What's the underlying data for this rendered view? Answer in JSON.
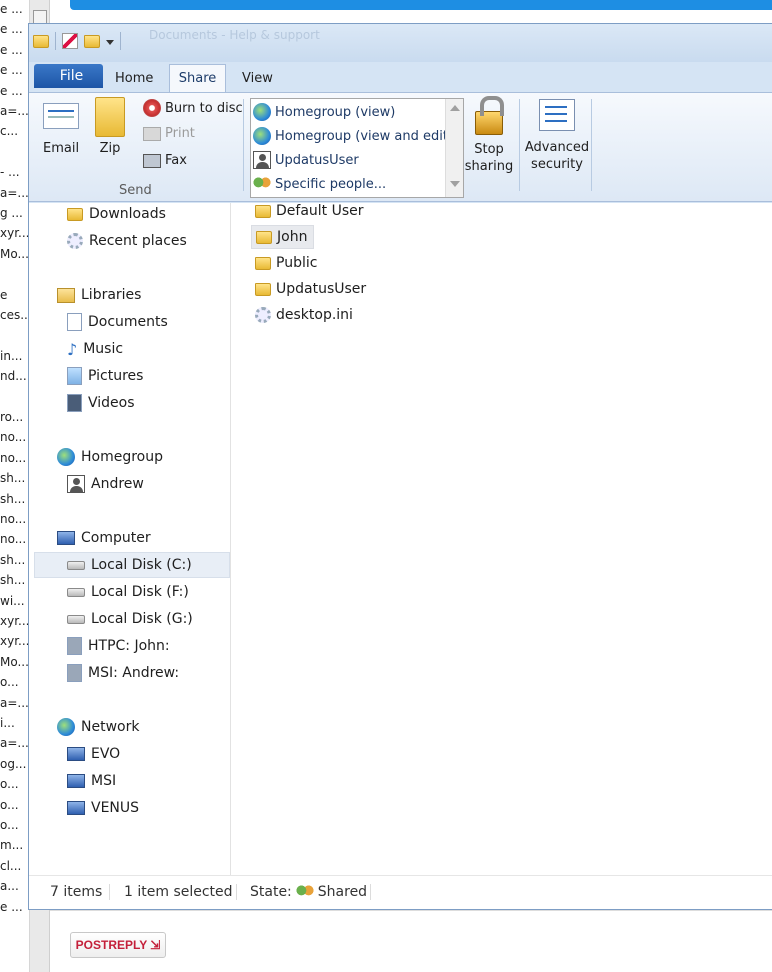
{
  "background": {
    "left_fragments": [
      "e ...",
      "e ...",
      "e ...",
      "e ...",
      "e ...",
      "a=...",
      "c...",
      "",
      "- ...",
      "a=...",
      "g ...",
      "xyr...",
      "Mo...",
      "",
      "e",
      "ces...",
      "",
      "in...",
      "nd...",
      "",
      "ro...",
      "no...",
      "no...",
      "sh...",
      "sh...",
      "no...",
      "no...",
      "sh...",
      "sh...",
      "wi...",
      "xyr...",
      "xyr...",
      "Mo...",
      "o...",
      "a=...",
      "i...",
      "a=...",
      "og...",
      "o...",
      "o...",
      "o...",
      "m...",
      "cl...",
      "a...",
      "e ..."
    ],
    "post_reply_label": "POSTREPLY",
    "post_reply_icon": "quote-arrow-icon"
  },
  "window": {
    "title": "Documents - Help & support",
    "quick_access": [
      "folder-icon",
      "properties-icon",
      "new-folder-icon",
      "customize-arrow-icon"
    ]
  },
  "ribbon": {
    "tabs": [
      {
        "label": "File"
      },
      {
        "label": "Home"
      },
      {
        "label": "Share",
        "active": true
      },
      {
        "label": "View"
      }
    ],
    "send": {
      "group_label": "Send",
      "email": "Email",
      "zip": "Zip",
      "burn": "Burn to disc",
      "print": "Print",
      "fax": "Fax"
    },
    "share_with": [
      {
        "label": "Homegroup (view)",
        "icon": "homegroup-icon"
      },
      {
        "label": "Homegroup (view and edit)",
        "icon": "homegroup-icon"
      },
      {
        "label": "UpdatusUser",
        "icon": "user-icon"
      },
      {
        "label": "Specific people...",
        "icon": "people-icon"
      }
    ],
    "stop_sharing": "Stop sharing",
    "advanced_security": "Advanced security"
  },
  "nav": {
    "favorites": [
      {
        "label": "Downloads",
        "icon": "downloads-icon"
      },
      {
        "label": "Recent places",
        "icon": "recent-places-icon"
      }
    ],
    "libraries": {
      "label": "Libraries",
      "items": [
        "Documents",
        "Music",
        "Pictures",
        "Videos"
      ]
    },
    "homegroup": {
      "label": "Homegroup",
      "items": [
        "Andrew"
      ]
    },
    "computer": {
      "label": "Computer",
      "items": [
        "Local Disk (C:)",
        "Local Disk (F:)",
        "Local Disk (G:)",
        "HTPC: John:",
        "MSI: Andrew:"
      ],
      "selected": "Local Disk (C:)"
    },
    "network": {
      "label": "Network",
      "items": [
        "EVO",
        "MSI",
        "VENUS"
      ]
    }
  },
  "files": [
    {
      "name": "Default User",
      "icon": "shortcut-folder-icon"
    },
    {
      "name": "John",
      "icon": "folder-icon",
      "selected": true
    },
    {
      "name": "Public",
      "icon": "folder-icon"
    },
    {
      "name": "UpdatusUser",
      "icon": "folder-icon"
    },
    {
      "name": "desktop.ini",
      "icon": "settings-file-icon"
    }
  ],
  "status": {
    "item_count": "7 items",
    "selection": "1 item selected",
    "state_label": "State:",
    "state_value": "Shared"
  }
}
